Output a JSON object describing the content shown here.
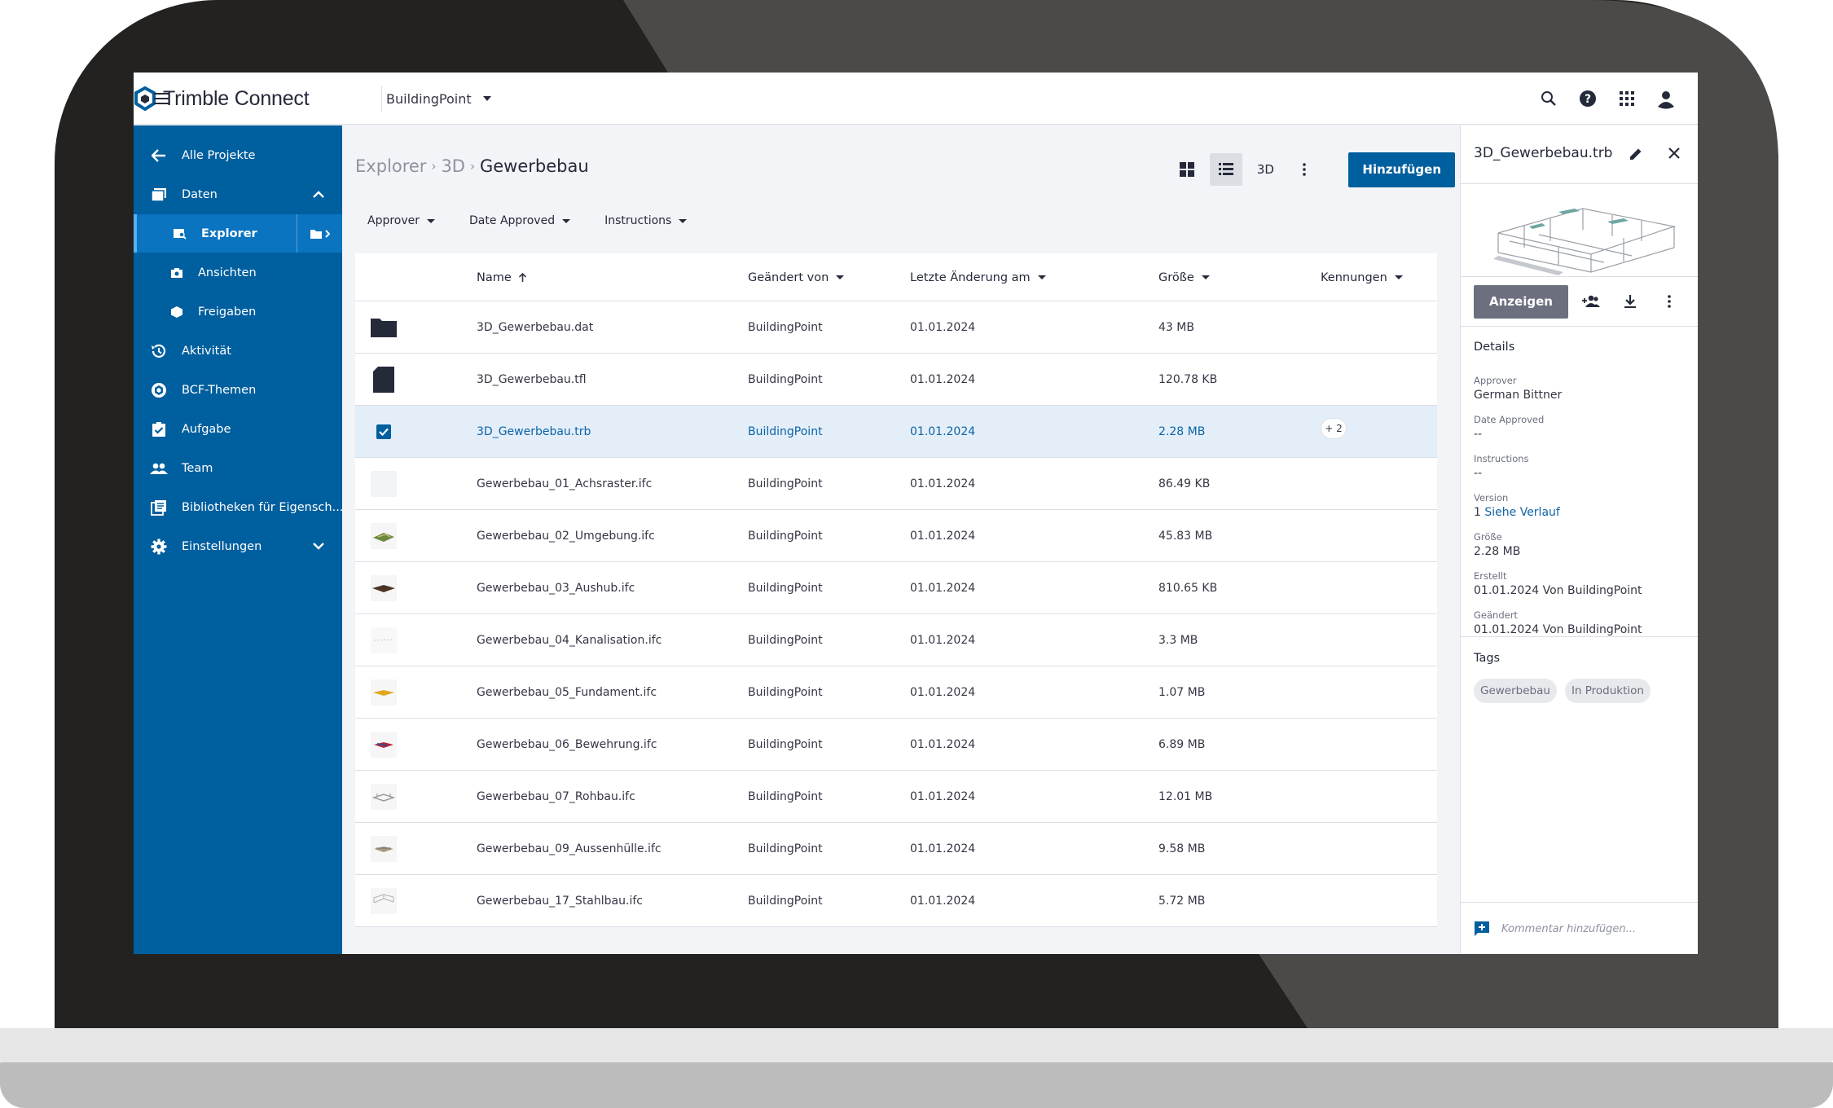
{
  "colors": {
    "brand_blue": "#005f9e",
    "sidebar_active": "#0a74c0",
    "selected_row": "#e3eef9",
    "link_blue": "#0e63a5",
    "panel_button": "#6b6f7e"
  },
  "topbar": {
    "app_name": "Trimble Connect",
    "project": "BuildingPoint",
    "icons": [
      "menu-icon",
      "search-icon",
      "help-icon",
      "apps-grid-icon",
      "user-avatar-icon"
    ]
  },
  "sidebar": {
    "items": [
      {
        "label": "Alle Projekte",
        "icon": "arrow-left-icon"
      },
      {
        "label": "Daten",
        "icon": "folder-stack-icon"
      },
      {
        "label": "Explorer",
        "icon": "explorer-icon"
      },
      {
        "label": "Ansichten",
        "icon": "camera-icon"
      },
      {
        "label": "Freigaben",
        "icon": "share-icon"
      },
      {
        "label": "Aktivität",
        "icon": "history-icon"
      },
      {
        "label": "BCF-Themen",
        "icon": "bcf-icon"
      },
      {
        "label": "Aufgabe",
        "icon": "clipboard-check-icon"
      },
      {
        "label": "Team",
        "icon": "people-icon"
      },
      {
        "label": "Bibliotheken für Eigensch...",
        "icon": "library-icon"
      },
      {
        "label": "Einstellungen",
        "icon": "gear-icon"
      }
    ]
  },
  "main": {
    "breadcrumb": [
      "Explorer",
      "3D",
      "Gewerbebau"
    ],
    "view_3d_label": "3D",
    "add_label": "Hinzufügen",
    "filters": [
      "Approver",
      "Date Approved",
      "Instructions"
    ],
    "columns": {
      "name": "Name",
      "changed_by": "Geändert von",
      "last_change": "Letzte Änderung am",
      "size": "Größe",
      "tags": "Kennungen"
    },
    "rows": [
      {
        "name": "3D_Gewerbebau.dat",
        "by": "BuildingPoint",
        "date": "01.01.2024",
        "size": "43 MB",
        "tags": ""
      },
      {
        "name": "3D_Gewerbebau.tfl",
        "by": "BuildingPoint",
        "date": "01.01.2024",
        "size": "120.78 KB",
        "tags": ""
      },
      {
        "name": "3D_Gewerbebau.trb",
        "by": "BuildingPoint",
        "date": "01.01.2024",
        "size": "2.28 MB",
        "tags": "+ 2"
      },
      {
        "name": "Gewerbebau_01_Achsraster.ifc",
        "by": "BuildingPoint",
        "date": "01.01.2024",
        "size": "86.49 KB",
        "tags": ""
      },
      {
        "name": "Gewerbebau_02_Umgebung.ifc",
        "by": "BuildingPoint",
        "date": "01.01.2024",
        "size": "45.83 MB",
        "tags": ""
      },
      {
        "name": "Gewerbebau_03_Aushub.ifc",
        "by": "BuildingPoint",
        "date": "01.01.2024",
        "size": "810.65 KB",
        "tags": ""
      },
      {
        "name": "Gewerbebau_04_Kanalisation.ifc",
        "by": "BuildingPoint",
        "date": "01.01.2024",
        "size": "3.3 MB",
        "tags": ""
      },
      {
        "name": "Gewerbebau_05_Fundament.ifc",
        "by": "BuildingPoint",
        "date": "01.01.2024",
        "size": "1.07 MB",
        "tags": ""
      },
      {
        "name": "Gewerbebau_06_Bewehrung.ifc",
        "by": "BuildingPoint",
        "date": "01.01.2024",
        "size": "6.89 MB",
        "tags": ""
      },
      {
        "name": "Gewerbebau_07_Rohbau.ifc",
        "by": "BuildingPoint",
        "date": "01.01.2024",
        "size": "12.01 MB",
        "tags": ""
      },
      {
        "name": "Gewerbebau_09_Aussenhülle.ifc",
        "by": "BuildingPoint",
        "date": "01.01.2024",
        "size": "9.58 MB",
        "tags": ""
      },
      {
        "name": "Gewerbebau_17_Stahlbau.ifc",
        "by": "BuildingPoint",
        "date": "01.01.2024",
        "size": "5.72 MB",
        "tags": ""
      }
    ]
  },
  "details": {
    "title": "3D_Gewerbebau.trb",
    "show_label": "Anzeigen",
    "section_details": "Details",
    "fields": {
      "approver_k": "Approver",
      "approver_v": "German Bittner",
      "date_approved_k": "Date Approved",
      "date_approved_v": "--",
      "instructions_k": "Instructions",
      "instructions_v": "--",
      "version_k": "Version",
      "version_num": "1",
      "version_link": "Siehe Verlauf",
      "size_k": "Größe",
      "size_v": "2.28 MB",
      "created_k": "Erstellt",
      "created_v": "01.01.2024 Von BuildingPoint",
      "changed_k": "Geändert",
      "changed_v": "01.01.2024 Von BuildingPoint"
    },
    "section_tags": "Tags",
    "tags": [
      "Gewerbebau",
      "In Produktion"
    ],
    "comment_placeholder": "Kommentar hinzufügen..."
  }
}
